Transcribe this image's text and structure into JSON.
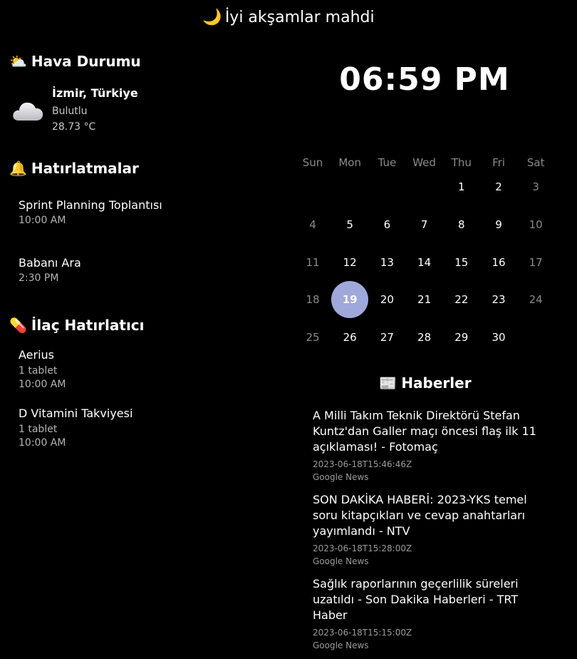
{
  "greeting": {
    "icon": "🌙",
    "text": "İyi akşamlar mahdi"
  },
  "weather": {
    "title_icon": "⛅",
    "title": "Hava Durumu",
    "icon": "cloud-icon",
    "city": "İzmir, Türkiye",
    "description": "Bulutlu",
    "temperature": "28.73 °C"
  },
  "reminders": {
    "title_icon": "🔔",
    "title": "Hatırlatmalar",
    "items": [
      {
        "title": "Sprint Planning Toplantısı",
        "time": "10:00 AM"
      },
      {
        "title": "Babanı Ara",
        "time": "2:30 PM"
      }
    ]
  },
  "medication": {
    "title_icon": "💊",
    "title": "İlaç Hatırlatıcı",
    "items": [
      {
        "name": "Aerius",
        "dose": "1 tablet",
        "time": "10:00 AM"
      },
      {
        "name": "D Vitamini Takviyesi",
        "dose": "1 tablet",
        "time": "10:00 AM"
      }
    ]
  },
  "clock": {
    "time": "06:59 PM"
  },
  "calendar": {
    "weekdays": [
      "Sun",
      "Mon",
      "Tue",
      "Wed",
      "Thu",
      "Fri",
      "Sat"
    ],
    "first_weekday_index": 4,
    "days_in_month": 30,
    "selected_day": 19,
    "selected_color": "#9fa8da",
    "weekend_color": "#8a8a8a"
  },
  "news": {
    "title_icon": "📰",
    "title": "Haberler",
    "items": [
      {
        "headline": "A Milli Takım Teknik Direktörü Stefan Kuntz'dan Galler maçı öncesi flaş ilk 11 açıklaması! - Fotomaç",
        "date": "2023-06-18T15:46:46Z",
        "source": "Google News"
      },
      {
        "headline": "SON DAKİKA HABERİ: 2023-YKS temel soru kitapçıkları ve cevap anahtarları yayımlandı - NTV",
        "date": "2023-06-18T15:28:00Z",
        "source": "Google News"
      },
      {
        "headline": "Sağlık raporlarının geçerlilik süreleri uzatıldı - Son Dakika Haberleri - TRT Haber",
        "date": "2023-06-18T15:15:00Z",
        "source": "Google News"
      }
    ]
  }
}
